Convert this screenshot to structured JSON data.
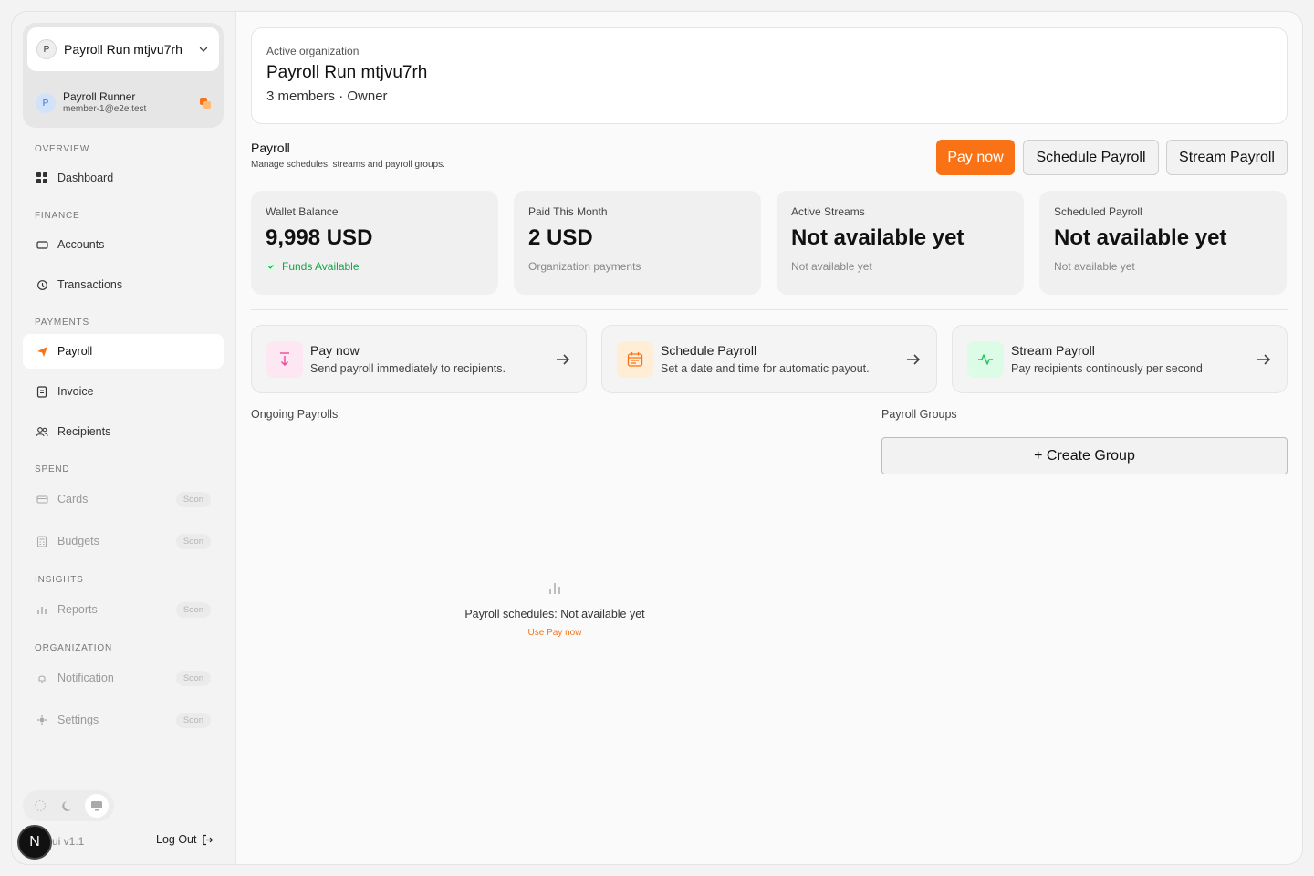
{
  "sidebar": {
    "org_initial": "P",
    "org_name": "Payroll Run mtjvu7rh",
    "user_initial": "P",
    "user_name": "Payroll Runner",
    "user_email": "member-1@e2e.test",
    "sections": {
      "overview": "OVERVIEW",
      "finance": "FINANCE",
      "payments": "PAYMENTS",
      "spend": "SPEND",
      "insights": "INSIGHTS",
      "organization": "ORGANIZATION"
    },
    "items": {
      "dashboard": "Dashboard",
      "accounts": "Accounts",
      "transactions": "Transactions",
      "payroll": "Payroll",
      "invoice": "Invoice",
      "recipients": "Recipients",
      "cards": "Cards",
      "budgets": "Budgets",
      "reports": "Reports",
      "notification": "Notification",
      "settings": "Settings"
    },
    "soon_label": "Soon",
    "badge_letter": "N",
    "version": "ui v1.1",
    "logout": "Log Out"
  },
  "header": {
    "label": "Active organization",
    "title": "Payroll Run mtjvu7rh",
    "subtitle": "3 members · Owner"
  },
  "payroll": {
    "title": "Payroll",
    "description": "Manage schedules, streams and payroll groups.",
    "buttons": {
      "pay_now": "Pay now",
      "schedule": "Schedule Payroll",
      "stream": "Stream Payroll"
    }
  },
  "stats": [
    {
      "label": "Wallet Balance",
      "value": "9,998 USD",
      "sub": "Funds Available"
    },
    {
      "label": "Paid This Month",
      "value": "2 USD",
      "sub": "Organization payments"
    },
    {
      "label": "Active Streams",
      "value": "Not available yet",
      "sub": "Not available yet"
    },
    {
      "label": "Scheduled Payroll",
      "value": "Not available yet",
      "sub": "Not available yet"
    }
  ],
  "actions": [
    {
      "title": "Pay now",
      "desc": "Send payroll immediately to recipients."
    },
    {
      "title": "Schedule Payroll",
      "desc": "Set a date and time for automatic payout."
    },
    {
      "title": "Stream Payroll",
      "desc": "Pay recipients continously per second"
    }
  ],
  "ongoing": {
    "label": "Ongoing Payrolls",
    "empty_text": "Payroll schedules: Not available yet",
    "empty_link": "Use Pay now"
  },
  "groups": {
    "label": "Payroll Groups",
    "create": "+ Create Group"
  },
  "colors": {
    "accent": "#f97316",
    "success": "#16a34a",
    "pink": "#ec4899",
    "green": "#22c55e"
  }
}
